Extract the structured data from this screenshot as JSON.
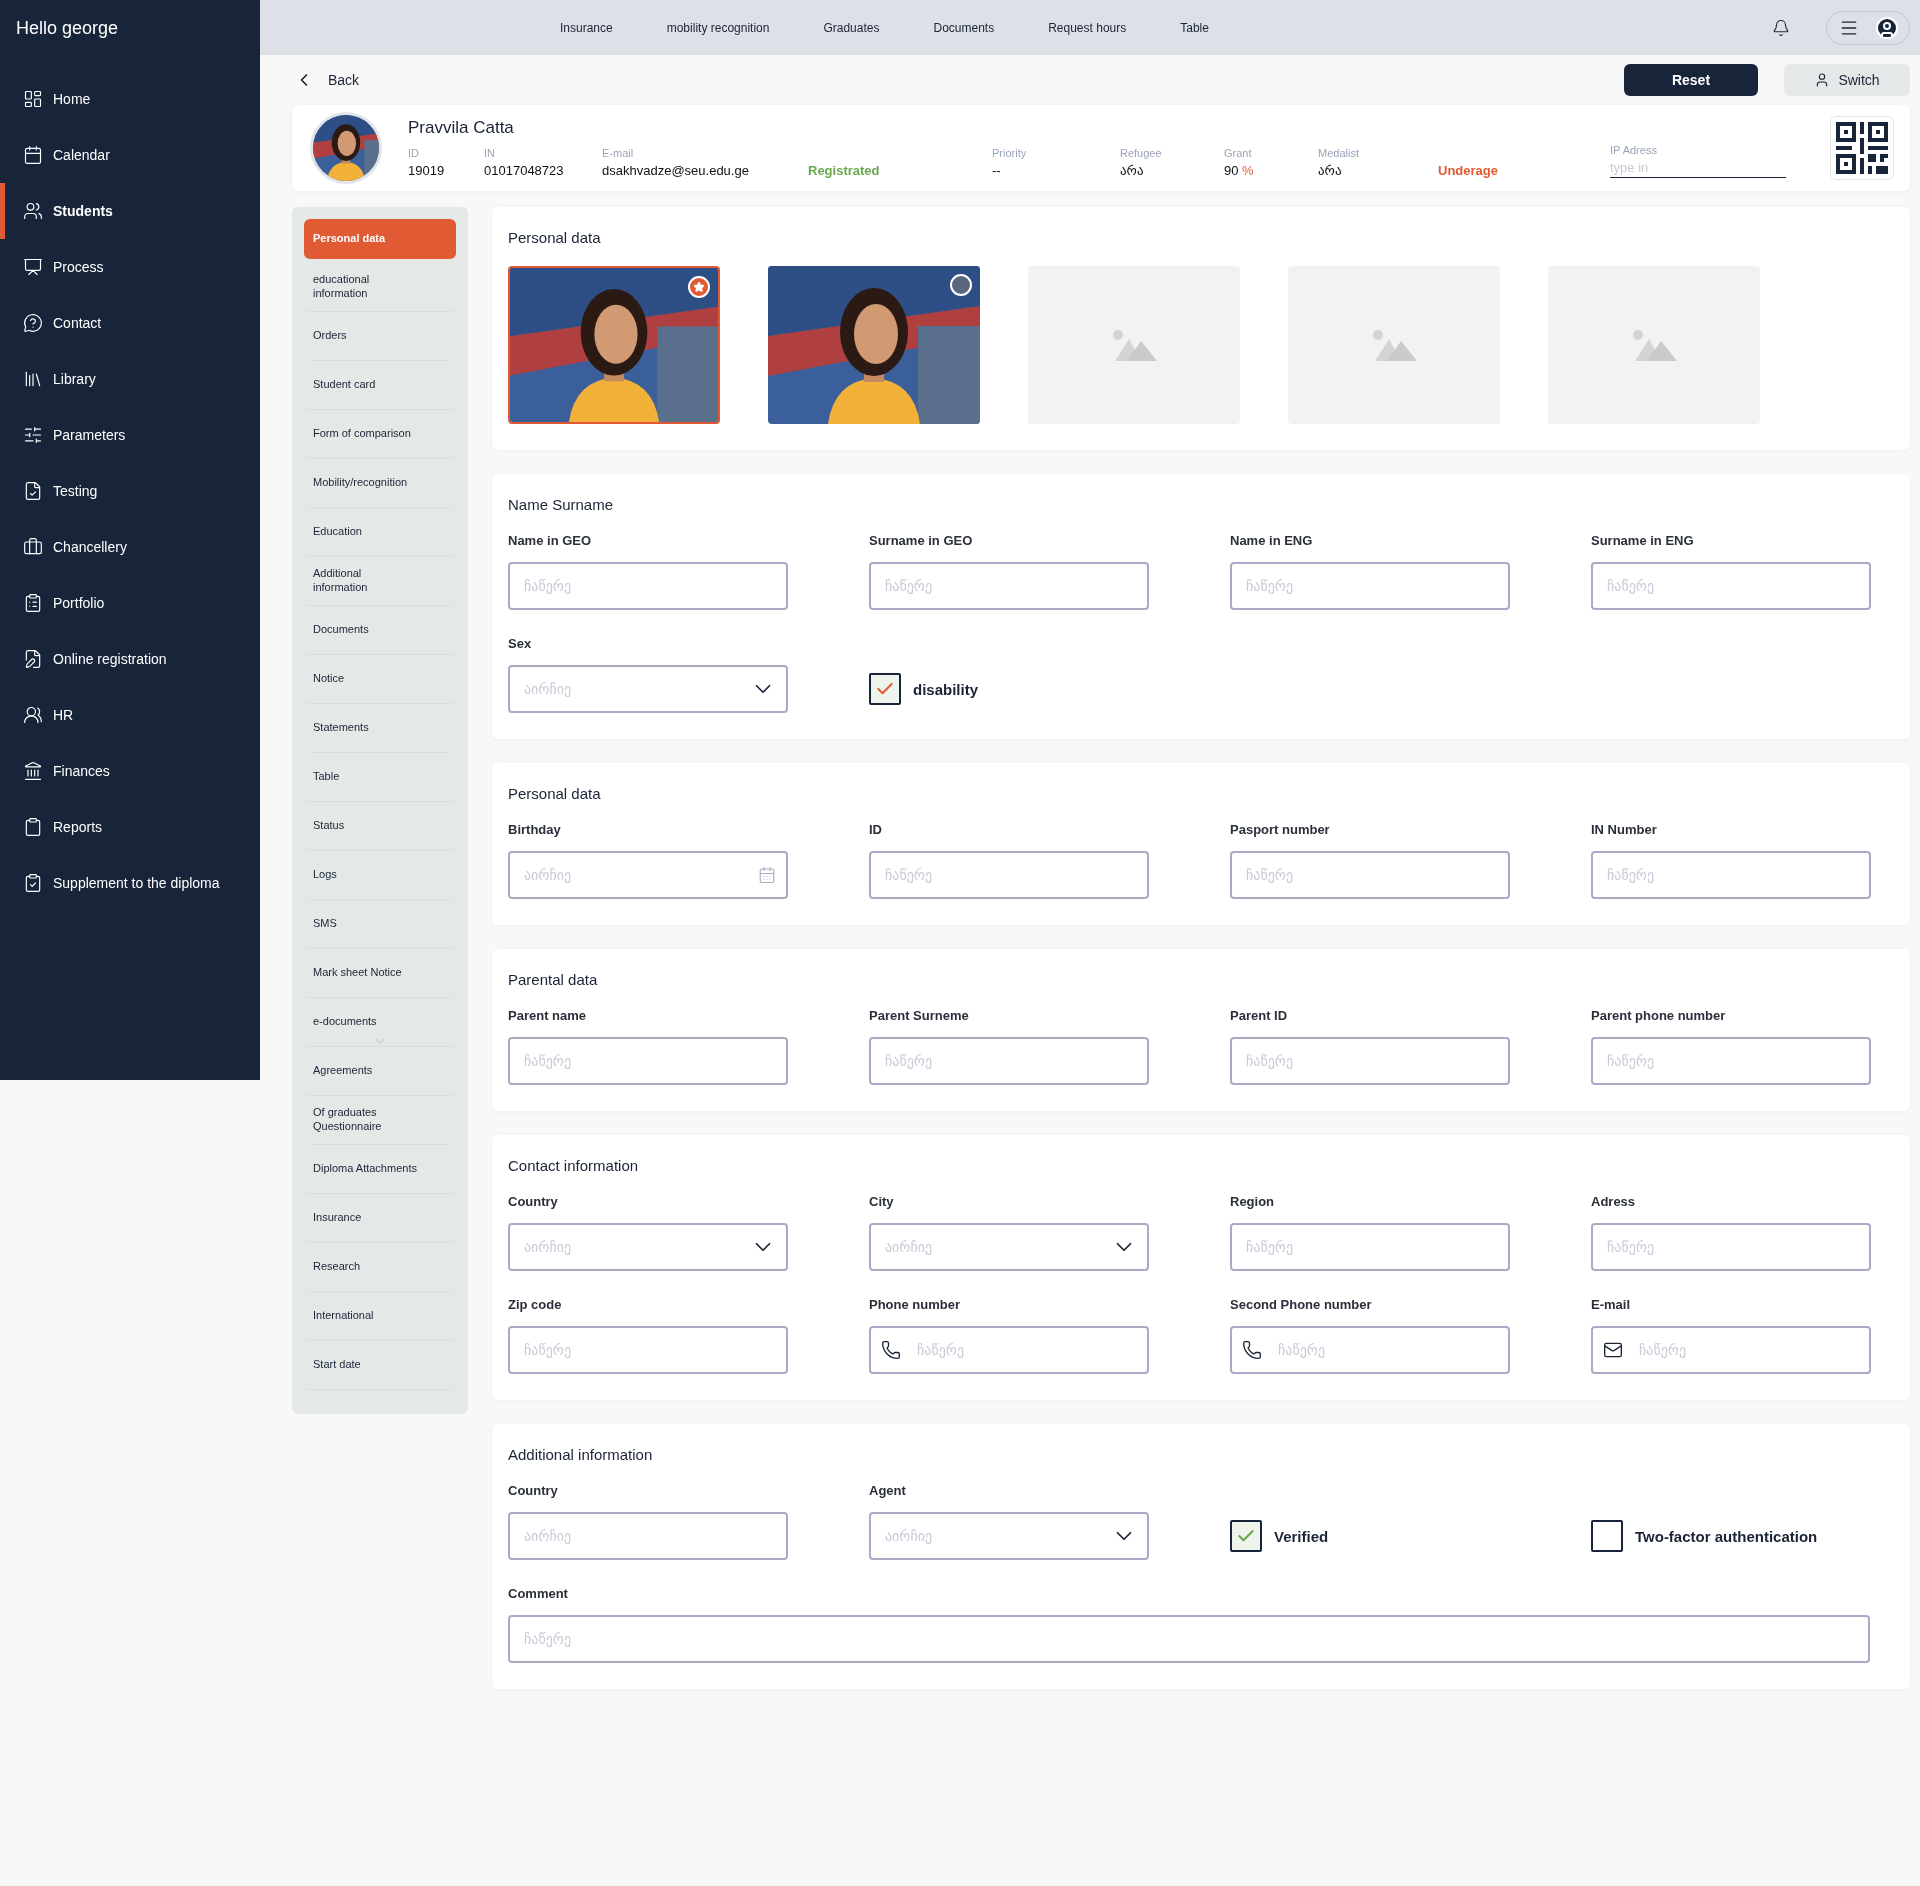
{
  "greeting": "Hello george",
  "sidebar": {
    "items": [
      {
        "label": "Home",
        "selected": false
      },
      {
        "label": "Calendar",
        "selected": false
      },
      {
        "label": "Students",
        "selected": true
      },
      {
        "label": "Process",
        "selected": false
      },
      {
        "label": "Contact",
        "selected": false
      },
      {
        "label": "Library",
        "selected": false
      },
      {
        "label": "Parameters",
        "selected": false
      },
      {
        "label": "Testing",
        "selected": false
      },
      {
        "label": "Chancellery",
        "selected": false
      },
      {
        "label": "Portfolio",
        "selected": false
      },
      {
        "label": "Online registration",
        "selected": false
      },
      {
        "label": "HR",
        "selected": false
      },
      {
        "label": "Finances",
        "selected": false
      },
      {
        "label": "Reports",
        "selected": false
      },
      {
        "label": "Supplement to the diploma",
        "selected": false
      }
    ]
  },
  "top_nav": [
    "Insurance",
    "mobility recognition",
    "Graduates",
    "Documents",
    "Request hours",
    "Table"
  ],
  "back": "Back",
  "buttons": {
    "reset": "Reset",
    "switch": "Switch"
  },
  "student": {
    "name": "Pravvila Catta",
    "info": [
      {
        "kind": "value",
        "label": "ID",
        "value": "19019"
      },
      {
        "kind": "value",
        "label": "IN",
        "value": "01017048723"
      },
      {
        "kind": "value",
        "label": "E-mail",
        "value": "dsakhvadze@seu.edu.ge"
      },
      {
        "kind": "status",
        "value": "Registrated",
        "color": "#6aa84f"
      },
      {
        "kind": "value",
        "label": "Priority",
        "value": "--"
      },
      {
        "kind": "value",
        "label": "Refugee",
        "value": "არა"
      },
      {
        "kind": "value",
        "label": "Grant",
        "value": "90",
        "suffix": "%"
      },
      {
        "kind": "value",
        "label": "Medalist",
        "value": "არა"
      },
      {
        "kind": "status",
        "value": "Underage",
        "color": "#e05a33"
      },
      {
        "kind": "input",
        "label": "IP Adress",
        "placeholder": "type in"
      }
    ]
  },
  "submenu": {
    "items": [
      {
        "label": "Personal data",
        "selected": true
      },
      {
        "label": "educational information",
        "selected": false
      },
      {
        "label": "Orders",
        "selected": false
      },
      {
        "label": "Student card",
        "selected": false
      },
      {
        "label": "Form of comparison",
        "selected": false
      },
      {
        "label": "Mobility/recognition",
        "selected": false
      },
      {
        "label": "Education",
        "selected": false
      },
      {
        "label": "Additional information",
        "selected": false
      },
      {
        "label": "Documents",
        "selected": false
      },
      {
        "label": "Notice",
        "selected": false
      },
      {
        "label": "Statements",
        "selected": false
      },
      {
        "label": "Table",
        "selected": false
      },
      {
        "label": "Status",
        "selected": false
      },
      {
        "label": "Logs",
        "selected": false
      },
      {
        "label": "SMS",
        "selected": false
      },
      {
        "label": "Mark sheet Notice",
        "selected": false
      },
      {
        "label": "e-documents",
        "selected": false
      },
      {
        "label": "Agreements",
        "selected": false
      },
      {
        "label": "Of graduates Questionnaire",
        "selected": false
      },
      {
        "label": "Diploma Attachments",
        "selected": false
      },
      {
        "label": "Insurance",
        "selected": false
      },
      {
        "label": "Research",
        "selected": false
      },
      {
        "label": "International",
        "selected": false
      },
      {
        "label": "Start date",
        "selected": false
      }
    ]
  },
  "photos": {
    "title": "Personal data",
    "items": [
      {
        "kind": "picture",
        "selected": true
      },
      {
        "kind": "picture",
        "selected": false
      },
      {
        "kind": "empty"
      },
      {
        "kind": "empty"
      },
      {
        "kind": "empty"
      }
    ]
  },
  "sections": [
    {
      "title": "Name Surname",
      "fields": [
        {
          "kind": "text",
          "label": "Name in GEO",
          "placeholder": "ჩაწერე"
        },
        {
          "kind": "text",
          "label": "Surname in GEO",
          "placeholder": "ჩაწერე"
        },
        {
          "kind": "text",
          "label": "Name in ENG",
          "placeholder": "ჩაწერე"
        },
        {
          "kind": "text",
          "label": "Surname in ENG",
          "placeholder": "ჩაწერე"
        },
        {
          "kind": "select",
          "label": "Sex",
          "placeholder": "აირჩიე"
        },
        {
          "kind": "checkbox",
          "label": "disability",
          "checked": true,
          "color": "#e05a33"
        }
      ]
    },
    {
      "title": "Personal data",
      "fields": [
        {
          "kind": "date",
          "label": "Birthday",
          "placeholder": "აირჩიე"
        },
        {
          "kind": "text",
          "label": "ID",
          "placeholder": "ჩაწერე"
        },
        {
          "kind": "text",
          "label": "Pasport number",
          "placeholder": "ჩაწერე"
        },
        {
          "kind": "text",
          "label": "IN Number",
          "placeholder": "ჩაწერე"
        }
      ]
    },
    {
      "title": "Parental data",
      "fields": [
        {
          "kind": "text",
          "label": "Parent name",
          "placeholder": "ჩაწერე"
        },
        {
          "kind": "text",
          "label": "Parent Surneme",
          "placeholder": "ჩაწერე"
        },
        {
          "kind": "text",
          "label": "Parent ID",
          "placeholder": "ჩაწერე"
        },
        {
          "kind": "text",
          "label": "Parent phone number",
          "placeholder": "ჩაწერე"
        }
      ]
    },
    {
      "title": "Contact information",
      "fields": [
        {
          "kind": "select",
          "label": "Country",
          "placeholder": "აირჩიე"
        },
        {
          "kind": "select",
          "label": "City",
          "placeholder": "აირჩიე"
        },
        {
          "kind": "text",
          "label": "Region",
          "placeholder": "ჩაწერე"
        },
        {
          "kind": "text",
          "label": "Adress",
          "placeholder": "ჩაწერე"
        },
        {
          "kind": "text",
          "label": "Zip code",
          "placeholder": "ჩაწერე"
        },
        {
          "kind": "phone",
          "label": "Phone number",
          "placeholder": "ჩაწერე"
        },
        {
          "kind": "phone",
          "label": "Second Phone number",
          "placeholder": "ჩაწერე"
        },
        {
          "kind": "email",
          "label": "E-mail",
          "placeholder": "ჩაწერე"
        }
      ]
    },
    {
      "title": "Additional information",
      "fields": [
        {
          "kind": "text",
          "label": "Country",
          "placeholder": "აირჩიე"
        },
        {
          "kind": "select",
          "label": "Agent",
          "placeholder": "აირჩიე"
        },
        {
          "kind": "checkbox",
          "label": "Verified",
          "checked": true,
          "color": "#6aa84f"
        },
        {
          "kind": "checkbox",
          "label": "Two-factor authentication",
          "checked": false
        },
        {
          "kind": "wide",
          "label": "Comment",
          "placeholder": "ჩაწერე"
        }
      ]
    }
  ]
}
